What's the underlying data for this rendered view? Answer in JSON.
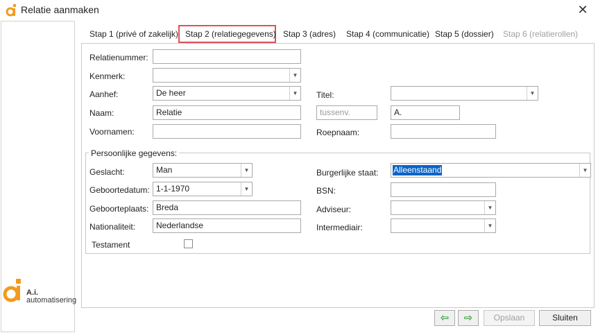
{
  "window": {
    "title": "Relatie aanmaken"
  },
  "brand": {
    "line1": "A.i.",
    "line2": "automatisering",
    "accent": "#f39a1e"
  },
  "tabs": [
    {
      "label": "Stap 1 (privé of zakelijk)"
    },
    {
      "label": "Stap 2 (relatiegegevens)",
      "active": true
    },
    {
      "label": "Stap 3 (adres)"
    },
    {
      "label": "Stap 4 (communicatie)"
    },
    {
      "label": "Stap 5 (dossier)"
    },
    {
      "label": "Stap 6 (relatierollen)",
      "disabled": true
    }
  ],
  "form": {
    "relatienummer": {
      "label": "Relatienummer:",
      "value": ""
    },
    "kenmerk": {
      "label": "Kenmerk:",
      "value": ""
    },
    "aanhef": {
      "label": "Aanhef:",
      "value": "De heer"
    },
    "titel": {
      "label": "Titel:",
      "value": ""
    },
    "naam": {
      "label": "Naam:",
      "value": "Relatie",
      "tussenvoegsel_placeholder": "tussenv.",
      "initialen": "A."
    },
    "voornamen": {
      "label": "Voornamen:",
      "value": ""
    },
    "roepnaam": {
      "label": "Roepnaam:",
      "value": ""
    }
  },
  "personal": {
    "title": "Persoonlijke gegevens:",
    "geslacht": {
      "label": "Geslacht:",
      "value": "Man"
    },
    "burgerlijke_staat": {
      "label": "Burgerlijke staat:",
      "value": "Alleenstaand"
    },
    "geboortedatum": {
      "label": "Geboortedatum:",
      "value": "1-1-1970"
    },
    "bsn": {
      "label": "BSN:",
      "value": ""
    },
    "geboorteplaats": {
      "label": "Geboorteplaats:",
      "value": "Breda"
    },
    "adviseur": {
      "label": "Adviseur:",
      "value": ""
    },
    "nationaliteit": {
      "label": "Nationaliteit:",
      "value": "Nederlandse"
    },
    "intermediair": {
      "label": "Intermediair:",
      "value": ""
    },
    "testament": {
      "label": "Testament",
      "checked": false
    }
  },
  "footer": {
    "back_icon": "arrow-left-icon",
    "next_icon": "arrow-right-icon",
    "back_glyph": "⇦",
    "next_glyph": "⇨",
    "save_label": "Opslaan",
    "close_label": "Sluiten"
  }
}
